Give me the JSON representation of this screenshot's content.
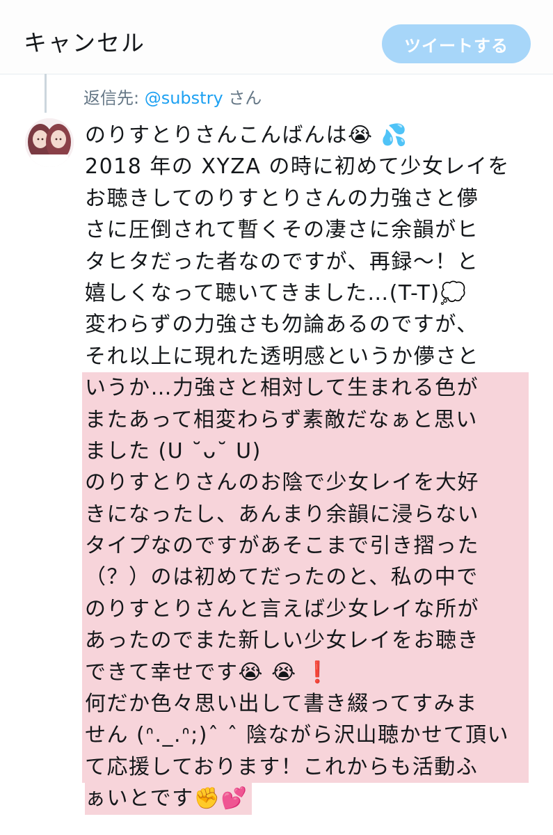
{
  "header": {
    "cancel_label": "キャンセル",
    "tweet_label": "ツイートする",
    "tweet_button_color": "#a7d6f9"
  },
  "reply": {
    "prefix": "返信先: ",
    "handle": "@substry",
    "suffix": " さん"
  },
  "avatar": {
    "icon": "avatar-two-girls"
  },
  "compose": {
    "highlight_color": "#f7d4da",
    "lines": [
      "のりすとりさんこんばんは😭 💦",
      "2018 年の XYZA の時に初めて少女レイを",
      "お聴きしてのりすとりさんの力強さと儚",
      "さに圧倒されて暫くその凄さに余韻がヒ",
      "タヒタだった者なのですが、再録〜！と",
      "嬉しくなって聴いてきました…(T-T)💭",
      "変わらずの力強さも勿論あるのですが、",
      "それ以上に現れた透明感というか儚さと",
      "いうか…力強さと相対して生まれる色が",
      "またあって相変わらず素敵だなぁと思い",
      "ました (U ˘ᴗ˘ U)",
      "のりすとりさんのお陰で少女レイを大好",
      "きになったし、あんまり余韻に浸らない",
      "タイプなのですがあそこまで引き摺った",
      "（？）のは初めてだったのと、私の中で",
      "のりすとりさんと言えば少女レイな所が",
      "あったのでまた新しい少女レイをお聴き",
      "できて幸せです😭 😭 ❗",
      "何だか色々思い出して書き綴ってすみま",
      "せん (ᐢ._.ᐢ;)ˆ ˆ 陰ながら沢山聴かせて頂い",
      "て応援しております！これからも活動ふ",
      "ぁいとです✊💕"
    ]
  }
}
